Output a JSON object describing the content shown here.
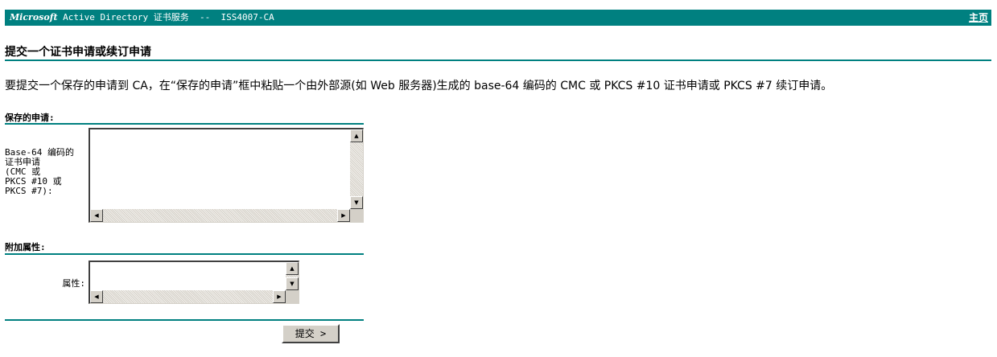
{
  "header": {
    "brand_ms": "Microsoft",
    "brand_rest": " Active Directory 证书服务  --  ISS4007-CA",
    "home_link": "主页"
  },
  "page": {
    "title": "提交一个证书申请或续订申请",
    "description": "要提交一个保存的申请到 CA，在“保存的申请”框中粘贴一个由外部源(如 Web 服务器)生成的 base-64 编码的 CMC 或 PKCS #10 证书申请或 PKCS #7 续订申请。"
  },
  "saved_request": {
    "section_title": "保存的申请:",
    "label_lines": [
      "Base-64 编码的",
      "证书申请",
      "(CMC 或",
      "PKCS #10 或",
      "PKCS #7):"
    ],
    "value": ""
  },
  "attributes": {
    "section_title": "附加属性:",
    "label": "属性:",
    "value": ""
  },
  "submit": {
    "label": "提交 >"
  },
  "colors": {
    "accent": "#008080",
    "button_face": "#d4d0c8"
  }
}
